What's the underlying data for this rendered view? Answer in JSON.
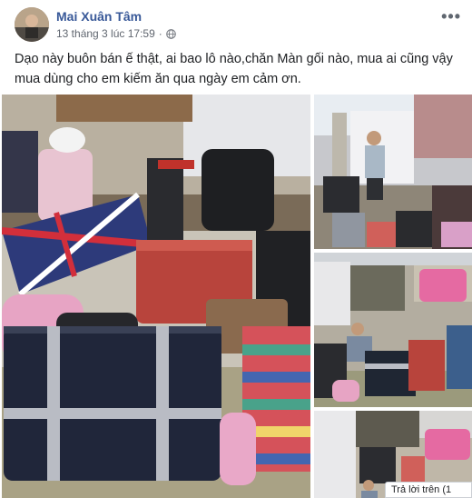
{
  "post": {
    "author": "Mai Xuân Tâm",
    "timestamp": "13 tháng 3 lúc 17:59",
    "privacy_separator": "·",
    "privacy_icon": "globe-icon",
    "more_icon": "more-options-icon",
    "more_label": "•••",
    "text_line1": "Dạo này buôn bán ế thật, ai bao lô nào,chăn Màn gối nào, mua ai cũng vậy",
    "text_line2": "mua dùng cho em kiếm ăn qua ngày em cảm ơn."
  },
  "photos": [
    {
      "name": "photo-main-luggage-pile"
    },
    {
      "name": "photo-seller-standing"
    },
    {
      "name": "photo-seller-sitting"
    },
    {
      "name": "photo-street-stall"
    }
  ],
  "footer_chip": "Trả lời trên (1"
}
